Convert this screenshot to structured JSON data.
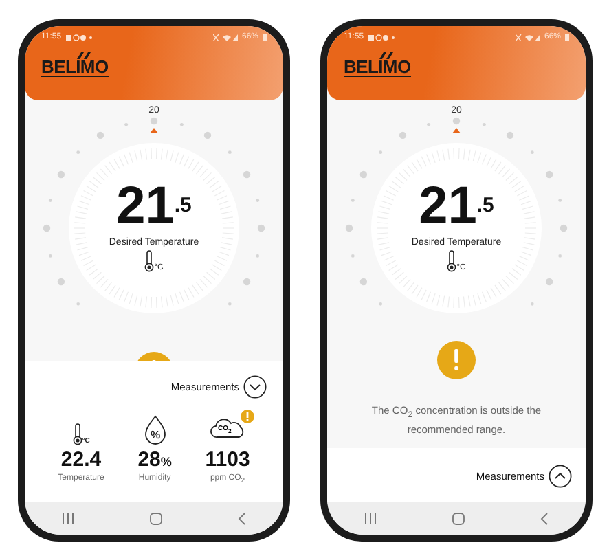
{
  "phones": [
    {
      "status_bar": {
        "time": "11:55",
        "battery": "66%"
      },
      "logo": "BELIMO",
      "dial": {
        "setpoint": "20",
        "value": "21",
        "decimal": ".5",
        "label": "Desired Temperature",
        "unit": "°C"
      },
      "measurements": {
        "label": "Measurements",
        "expanded": true,
        "items": [
          {
            "kind": "temperature",
            "icon_text": "°C",
            "value": "22.4",
            "label": "Temperature",
            "alert": false
          },
          {
            "kind": "humidity",
            "icon_text": "%",
            "value": "28",
            "unit": "%",
            "label": "Humidity",
            "alert": false
          },
          {
            "kind": "co2",
            "icon_text": "CO$_{2}$",
            "value": "1103",
            "label": "ppm CO$_{2}$",
            "alert": true
          }
        ]
      }
    },
    {
      "status_bar": {
        "time": "11:55",
        "battery": "66%"
      },
      "logo": "BELIMO",
      "dial": {
        "setpoint": "20",
        "value": "21",
        "decimal": ".5",
        "label": "Desired Temperature",
        "unit": "°C"
      },
      "alert": {
        "message": "The CO$_{2}$ concentration is outside the recommended range."
      },
      "measurements": {
        "label": "Measurements",
        "expanded": false
      }
    }
  ]
}
